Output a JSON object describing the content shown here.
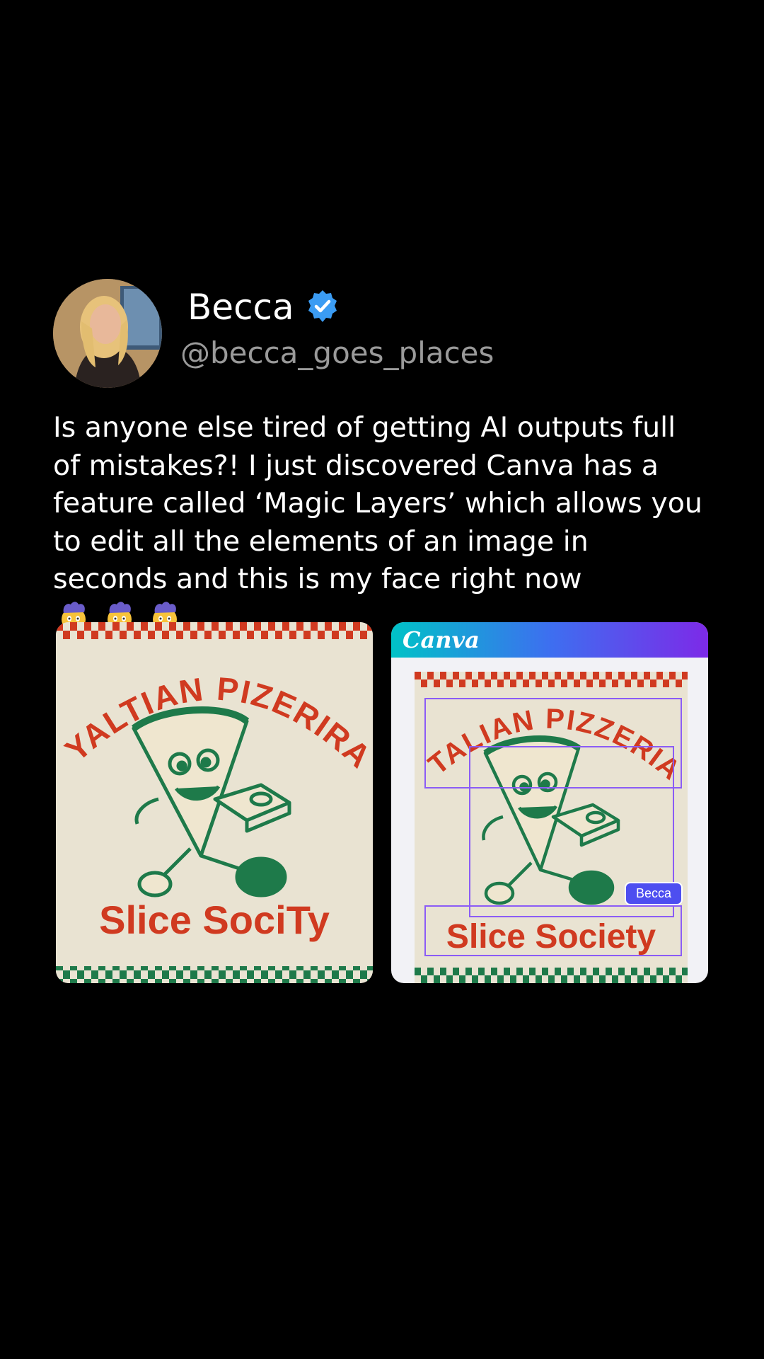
{
  "post": {
    "author_name": "Becca",
    "handle": "@becca_goes_places",
    "verified": true,
    "verified_color": "#3b9cf3",
    "text": "Is anyone else tired of getting AI outputs full of mistakes?! I just discovered Canva has a feature called ‘Magic Layers’ which allows you to edit all the elements of an image in seconds and this is my face right now",
    "emojis": [
      "exploding-head-emoji",
      "exploding-head-emoji",
      "exploding-head-emoji"
    ]
  },
  "left_image": {
    "arc_title": "IYALTIAN PIZERIRA",
    "bottom_text": "Slice SociTy"
  },
  "right_image": {
    "app_logo": "Canva",
    "arc_title": "ITALIAN PIZZERIA",
    "bottom_text": "Slice Society",
    "collaborator_tag": "Becca"
  },
  "colors": {
    "background": "#000000",
    "poster_cream": "#e9e3d2",
    "pizza_red": "#d03a20",
    "mascot_green": "#1e7a4a",
    "selection_purple": "#8b5cf6"
  }
}
